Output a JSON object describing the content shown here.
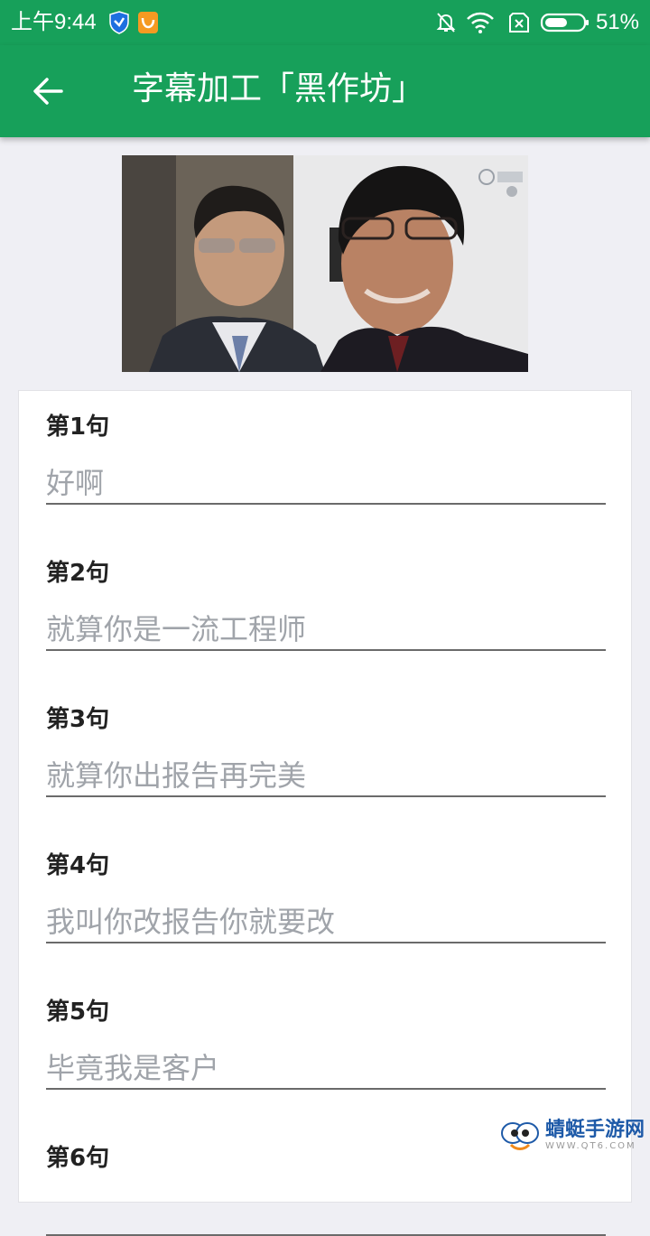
{
  "status_bar": {
    "time": "上午9:44",
    "battery": "51%",
    "icons": [
      "shield-app-icon",
      "uc-app-icon",
      "bell-muted-icon",
      "wifi-icon",
      "no-sim-icon",
      "battery-icon"
    ]
  },
  "app_bar": {
    "title": "字幕加工「黑作坊」",
    "back_icon": "arrow-left-icon"
  },
  "entries": [
    {
      "label": "第1句",
      "text": "好啊"
    },
    {
      "label": "第2句",
      "text": "就算你是一流工程师"
    },
    {
      "label": "第3句",
      "text": "就算你出报告再完美"
    },
    {
      "label": "第4句",
      "text": "我叫你改报告你就要改"
    },
    {
      "label": "第5句",
      "text": "毕竟我是客户"
    },
    {
      "label": "第6句",
      "text": ""
    }
  ],
  "watermark": {
    "text": "蜻蜓手游网",
    "sub": "WWW.QT6.COM"
  },
  "colors": {
    "primary": "#17a05a",
    "background": "#efeff4",
    "hint_text": "#a0a4aa",
    "underline": "#6a6a6a"
  }
}
